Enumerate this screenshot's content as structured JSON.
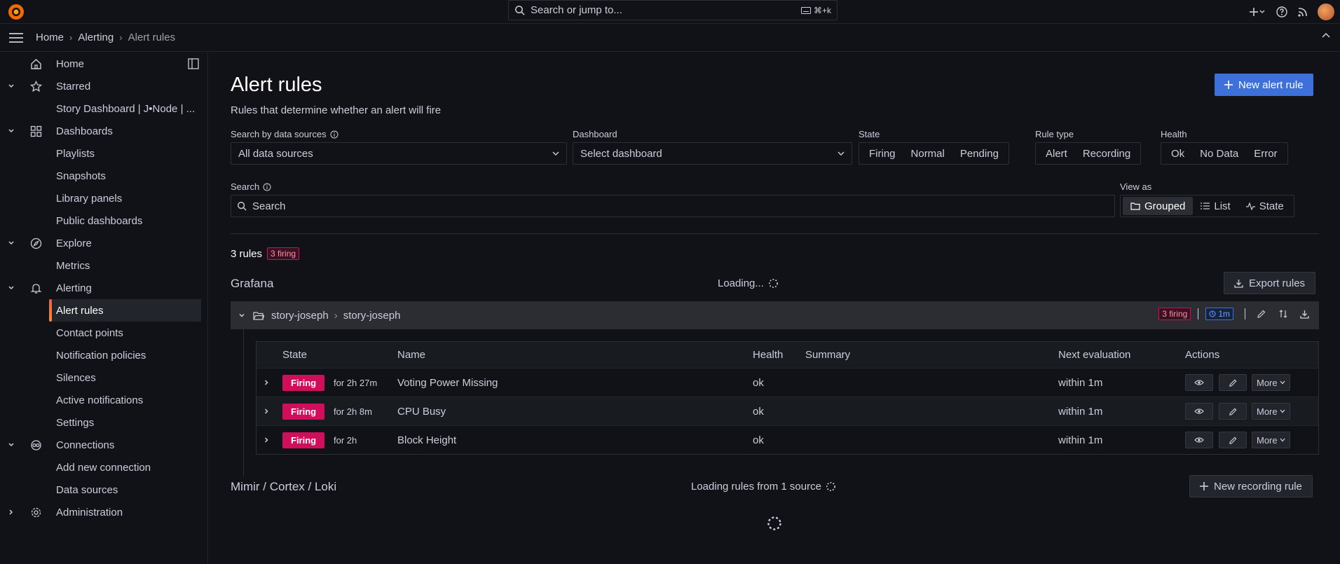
{
  "topbar": {
    "search_placeholder": "Search or jump to...",
    "search_shortcut": "⌘+k"
  },
  "breadcrumb": [
    "Home",
    "Alerting",
    "Alert rules"
  ],
  "sidebar": {
    "items": [
      {
        "label": "Home"
      },
      {
        "label": "Starred"
      },
      {
        "label": "Story Dashboard | J•Node | ..."
      },
      {
        "label": "Dashboards"
      },
      {
        "label": "Playlists"
      },
      {
        "label": "Snapshots"
      },
      {
        "label": "Library panels"
      },
      {
        "label": "Public dashboards"
      },
      {
        "label": "Explore"
      },
      {
        "label": "Metrics"
      },
      {
        "label": "Alerting"
      },
      {
        "label": "Alert rules"
      },
      {
        "label": "Contact points"
      },
      {
        "label": "Notification policies"
      },
      {
        "label": "Silences"
      },
      {
        "label": "Active notifications"
      },
      {
        "label": "Settings"
      },
      {
        "label": "Connections"
      },
      {
        "label": "Add new connection"
      },
      {
        "label": "Data sources"
      },
      {
        "label": "Administration"
      }
    ]
  },
  "page": {
    "title": "Alert rules",
    "subtitle": "Rules that determine whether an alert will fire",
    "new_rule_label": "New alert rule"
  },
  "filters": {
    "datasource_label": "Search by data sources",
    "datasource_value": "All data sources",
    "dashboard_label": "Dashboard",
    "dashboard_value": "Select dashboard",
    "state_label": "State",
    "state_options": [
      "Firing",
      "Normal",
      "Pending"
    ],
    "ruletype_label": "Rule type",
    "ruletype_options": [
      "Alert",
      "Recording"
    ],
    "health_label": "Health",
    "health_options": [
      "Ok",
      "No Data",
      "Error"
    ],
    "search_label": "Search",
    "search_placeholder": "Search",
    "viewas_label": "View as",
    "viewas_options": [
      "Grouped",
      "List",
      "State"
    ]
  },
  "summary": {
    "count": "3 rules",
    "firing": "3 firing"
  },
  "grafana_section": {
    "title": "Grafana",
    "loading": "Loading...",
    "export_label": "Export rules",
    "folder": "story-joseph",
    "group": "story-joseph",
    "firing_badge": "3 firing",
    "interval": "1m"
  },
  "table": {
    "headers": [
      "State",
      "Name",
      "Health",
      "Summary",
      "Next evaluation",
      "Actions"
    ],
    "rows": [
      {
        "state": "Firing",
        "for": "for 2h 27m",
        "name": "Voting Power Missing",
        "health": "ok",
        "summary": "",
        "next": "within 1m",
        "more": "More"
      },
      {
        "state": "Firing",
        "for": "for 2h 8m",
        "name": "CPU Busy",
        "health": "ok",
        "summary": "",
        "next": "within 1m",
        "more": "More"
      },
      {
        "state": "Firing",
        "for": "for 2h",
        "name": "Block Height",
        "health": "ok",
        "summary": "",
        "next": "within 1m",
        "more": "More"
      }
    ]
  },
  "mimir_section": {
    "title": "Mimir / Cortex / Loki",
    "loading": "Loading rules from 1 source",
    "new_recording_label": "New recording rule"
  },
  "colors": {
    "accent": "#3d71d9",
    "firing": "#d10e5c",
    "active_bar": "#f55f3e",
    "background": "#111217"
  }
}
